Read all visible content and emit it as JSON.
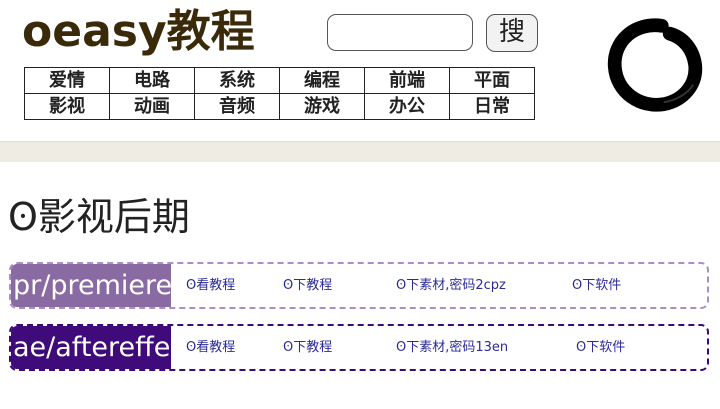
{
  "header": {
    "logo": "oeasy教程",
    "search_placeholder": "",
    "search_button": "搜",
    "nav_rows": [
      [
        "爱情",
        "电路",
        "系统",
        "编程",
        "前端",
        "平面"
      ],
      [
        "影视",
        "动画",
        "音频",
        "游戏",
        "办公",
        "日常"
      ]
    ]
  },
  "section": {
    "title": "ʘ影视后期"
  },
  "rows": [
    {
      "tag": "pr/premiere",
      "tag_color": "#8a6aa3",
      "links": [
        "ʘ看教程",
        "ʘ下教程",
        "ʘ下素材,密码2cpz",
        "ʘ下软件"
      ]
    },
    {
      "tag": "ae/aftereffects",
      "tag_color": "#3f0a7a",
      "links": [
        "ʘ看教程",
        "ʘ下教程",
        "ʘ下素材,密码13en",
        "ʘ下软件"
      ]
    }
  ],
  "colors": {
    "logo": "#3a2a0a",
    "link": "#2b2b9a",
    "divider": "#efece4"
  }
}
